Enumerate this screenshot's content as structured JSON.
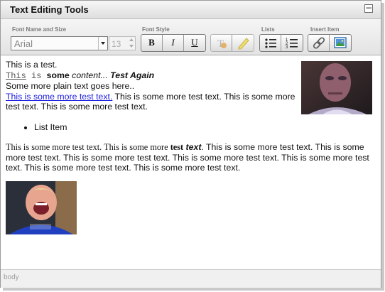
{
  "panel": {
    "title": "Text Editing Tools",
    "collapse_label": "−"
  },
  "toolbar": {
    "groups": {
      "font_name_size": "Font Name and Size",
      "font_style": "Font Style",
      "lists": "Lists",
      "insert_item": "Insert Item"
    },
    "font_name": "Arial",
    "font_size": "13",
    "bold_label": "B",
    "italic_label": "I",
    "underline_label": "U"
  },
  "content": {
    "line1": "This is a test.",
    "line2": {
      "mono": "This",
      "mono2": " is ",
      "bold": "some",
      "italic": " content...",
      "bold_italic": " Test Again"
    },
    "line3": "Some more plain text goes here..",
    "line4": {
      "link": "This is some more test text.",
      "rest": " This is some more test text. This is some more test text. This is some more test text."
    },
    "list_item": "List Item",
    "para": {
      "serif": "This is some more test text. This is some more ",
      "serif_bold": "test",
      "serif_bold_italic": " text",
      "rest": ". This is some more test text. This is some more test text. This is some more test text. This is some more test text. This is some more test text. This is some more test text. This is some more test text."
    }
  },
  "statusbar": {
    "path": "body"
  }
}
